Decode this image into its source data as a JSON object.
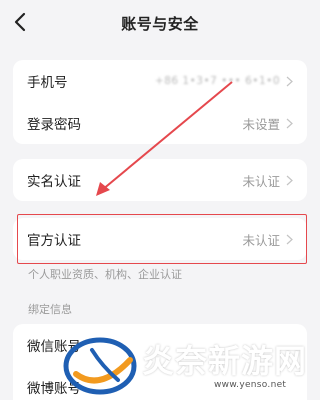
{
  "header": {
    "title": "账号与安全"
  },
  "account_card": {
    "phone_label": "手机号",
    "phone_value": "+86 1•3•7 ••• 6•1•0",
    "password_label": "登录密码",
    "password_value": "未设置"
  },
  "realname_card": {
    "label": "实名认证",
    "value": "未认证"
  },
  "official_card": {
    "label": "官方认证",
    "value": "未认证",
    "hint": "个人职业资质、机构、企业认证"
  },
  "bind_section": {
    "title": "绑定信息",
    "wechat_label": "微信账号",
    "weibo_label": "微博账号"
  },
  "watermark": {
    "text": "炎奈新游网",
    "url": "www.yenso.net"
  },
  "colors": {
    "background": "#f4f4f6",
    "card": "#ffffff",
    "highlight": "#e5484d",
    "muted_text": "#9a9a9a"
  }
}
